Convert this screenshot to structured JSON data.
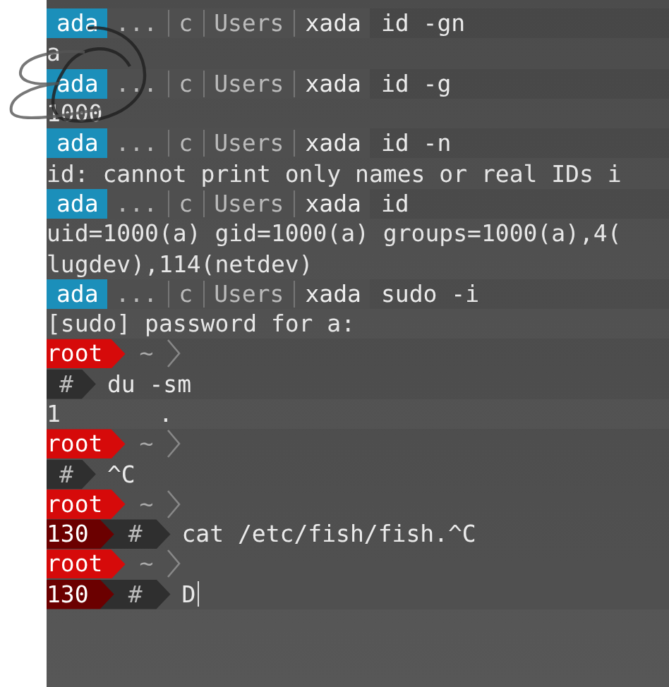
{
  "terminal": {
    "lines": [
      {
        "kind": "user_prompt",
        "user": "ada",
        "path": [
          "...",
          "c",
          "Users",
          "xada"
        ],
        "command": "id -gn"
      },
      {
        "kind": "output",
        "text": "a"
      },
      {
        "kind": "user_prompt",
        "user": "ada",
        "path": [
          "...",
          "c",
          "Users",
          "xada"
        ],
        "command": "id -g"
      },
      {
        "kind": "output",
        "text": "1000"
      },
      {
        "kind": "user_prompt",
        "user": "ada",
        "path": [
          "...",
          "c",
          "Users",
          "xada"
        ],
        "command": "id -n"
      },
      {
        "kind": "output",
        "text": "id: cannot print only names or real IDs i"
      },
      {
        "kind": "user_prompt",
        "user": "ada",
        "path": [
          "...",
          "c",
          "Users",
          "xada"
        ],
        "command": "id"
      },
      {
        "kind": "output",
        "text": "uid=1000(a) gid=1000(a) groups=1000(a),4("
      },
      {
        "kind": "output",
        "text": "lugdev),114(netdev)"
      },
      {
        "kind": "user_prompt",
        "user": "ada",
        "path": [
          "...",
          "c",
          "Users",
          "xada"
        ],
        "command": "sudo -i"
      },
      {
        "kind": "output",
        "text": "[sudo] password for a:"
      },
      {
        "kind": "root_prompt",
        "user": "root",
        "dir": "~"
      },
      {
        "kind": "hash_prompt",
        "symbol": "#",
        "command": "du -sm"
      },
      {
        "kind": "output",
        "text": "1       ."
      },
      {
        "kind": "root_prompt",
        "user": "root",
        "dir": "~"
      },
      {
        "kind": "hash_prompt",
        "symbol": "#",
        "command": "^C"
      },
      {
        "kind": "root_prompt",
        "user": "root",
        "dir": "~"
      },
      {
        "kind": "hash_prompt",
        "status": "130",
        "symbol": "#",
        "command": "cat /etc/fish/fish.^C"
      },
      {
        "kind": "root_prompt",
        "user": "root",
        "dir": "~"
      },
      {
        "kind": "hash_prompt",
        "status": "130",
        "symbol": "#",
        "command": "D",
        "cursor": true
      }
    ]
  }
}
